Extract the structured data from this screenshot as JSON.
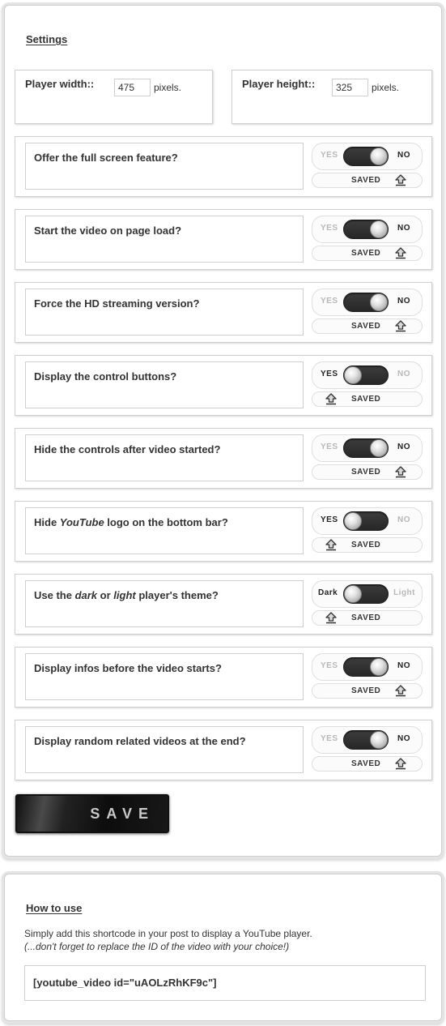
{
  "settings": {
    "title": "Settings",
    "player_width": {
      "label": "Player width::",
      "value": "475",
      "unit": "pixels."
    },
    "player_height": {
      "label": "Player height::",
      "value": "325",
      "unit": "pixels."
    },
    "options": [
      {
        "question": "Offer the full screen feature?",
        "left_label": "YES",
        "right_label": "NO",
        "state": "right",
        "saved_label": "SAVED"
      },
      {
        "question": "Start the video on page load?",
        "left_label": "YES",
        "right_label": "NO",
        "state": "right",
        "saved_label": "SAVED"
      },
      {
        "question": "Force the HD streaming version?",
        "left_label": "YES",
        "right_label": "NO",
        "state": "right",
        "saved_label": "SAVED"
      },
      {
        "question": "Display the control buttons?",
        "left_label": "YES",
        "right_label": "NO",
        "state": "left",
        "saved_label": "SAVED"
      },
      {
        "question": "Hide the controls after video started?",
        "left_label": "YES",
        "right_label": "NO",
        "state": "right",
        "saved_label": "SAVED"
      },
      {
        "question_parts": [
          "Hide ",
          "YouTube",
          " logo on the bottom bar?"
        ],
        "left_label": "YES",
        "right_label": "NO",
        "state": "left",
        "saved_label": "SAVED"
      },
      {
        "question_parts": [
          "Use the ",
          "dark",
          " or ",
          "light",
          " player's theme?"
        ],
        "left_label": "Dark",
        "right_label": "Light",
        "state": "left",
        "saved_label": "SAVED"
      },
      {
        "question": "Display infos before the video starts?",
        "left_label": "YES",
        "right_label": "NO",
        "state": "right",
        "saved_label": "SAVED"
      },
      {
        "question": "Display random related videos at the end?",
        "left_label": "YES",
        "right_label": "NO",
        "state": "right",
        "saved_label": "SAVED"
      }
    ],
    "save_button": "SAVE"
  },
  "howto": {
    "title": "How to use",
    "line1": "Simply add this shortcode in your post to display a YouTube player.",
    "line2": "(...don't forget to replace the ID of the video with your choice!)",
    "shortcode": "[youtube_video id=\"uAOLzRhKF9c\"]"
  },
  "colors": {
    "switch_track": "#2b2b2b",
    "active_label": "#222222",
    "inactive_label": "#b8b8b8",
    "border": "#cfcfcf"
  },
  "icons": {
    "saved_arrow": "up-arrow-icon"
  }
}
